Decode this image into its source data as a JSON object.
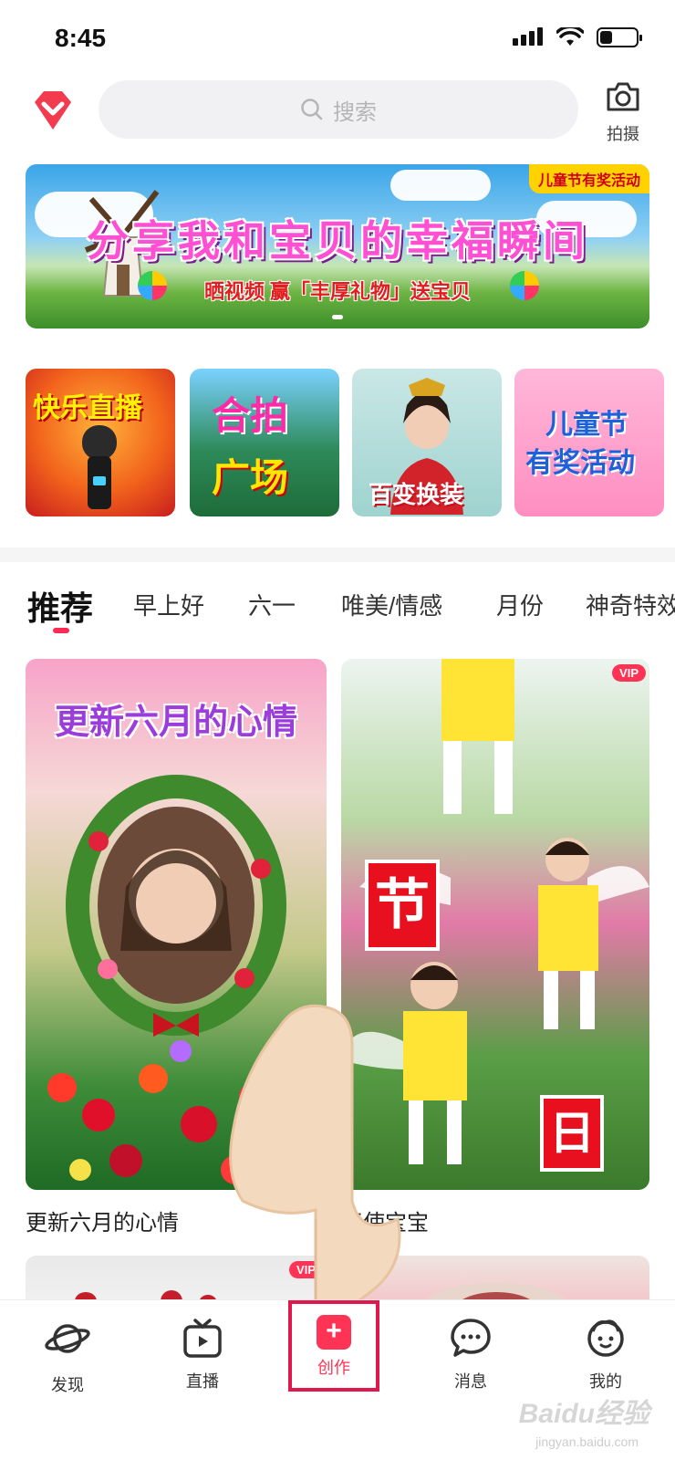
{
  "status_bar": {
    "time": "8:45",
    "battery_level": 0.35
  },
  "header": {
    "search_placeholder": "搜索",
    "camera_label": "拍摄"
  },
  "banner": {
    "tag": "儿童节有奖活动",
    "title": "分享我和宝贝的幸福瞬间",
    "subtitle": "晒视频 赢「丰厚礼物」送宝贝"
  },
  "tiles": [
    {
      "text": "快乐直播"
    },
    {
      "line1": "合拍",
      "line2": "广场"
    },
    {
      "text": "百变换装"
    },
    {
      "line1": "儿童节",
      "line2": "有奖活动"
    }
  ],
  "tabs": [
    "推荐",
    "早上好",
    "六一",
    "唯美/情感",
    "月份",
    "神奇特效"
  ],
  "feed": {
    "card1": {
      "overlay_title": "更新六月的心情",
      "caption": "更新六月的心情"
    },
    "card2": {
      "vip": "VIP",
      "overlay_char1": "节",
      "overlay_char2": "日",
      "caption": "天使宝宝"
    },
    "card3": {
      "vip": "VIP"
    }
  },
  "bottom_nav": [
    {
      "label": "发现",
      "icon": "planet-icon"
    },
    {
      "label": "直播",
      "icon": "tv-icon"
    },
    {
      "label": "创作",
      "icon": "plus-icon"
    },
    {
      "label": "消息",
      "icon": "chat-bubble-icon"
    },
    {
      "label": "我的",
      "icon": "face-icon"
    }
  ],
  "watermark": {
    "main": "Baidu经验",
    "sub": "jingyan.baidu.com"
  },
  "colors": {
    "accent": "#ff3355",
    "highlight_frame": "#e0184d"
  }
}
